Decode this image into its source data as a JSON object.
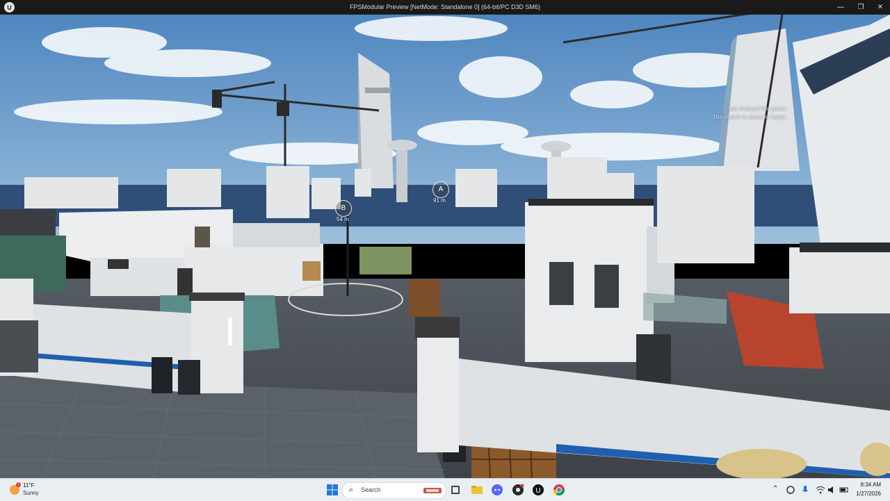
{
  "window": {
    "title": "FPSModular Preview [NetMode: Standalone 0]  (64-bit/PC D3D SM6)",
    "app_icon": "unreal-engine-icon",
    "minimize_glyph": "—",
    "maximize_glyph": "❐",
    "close_glyph": "✕"
  },
  "hud": {
    "objectives": [
      {
        "label": "A",
        "distance": "91 m"
      },
      {
        "label": "B",
        "distance": "54 m"
      }
    ],
    "messages": [
      "has entered the game.",
      "The match is about to begin."
    ]
  },
  "taskbar": {
    "weather": {
      "temp": "11°F",
      "condition": "Sunny",
      "badge": "1"
    },
    "search_placeholder": "Search",
    "apps": [
      "windows-start-icon",
      "search-icon",
      "task-view-icon",
      "file-explorer-icon",
      "discord-icon",
      "obs-icon",
      "unreal-engine-icon",
      "chrome-icon"
    ],
    "tray": {
      "chevron": "⌃",
      "time": "8:34 AM",
      "date": "1/27/2026"
    }
  },
  "colors": {
    "sky": "#5f95c9",
    "ground": "#4b5158",
    "container_red": "#b9442e",
    "container_green": "#7d9460",
    "container_teal": "#5a8c8a",
    "pallet": "#8b5a2b",
    "taskbar": "#e9eef3"
  }
}
